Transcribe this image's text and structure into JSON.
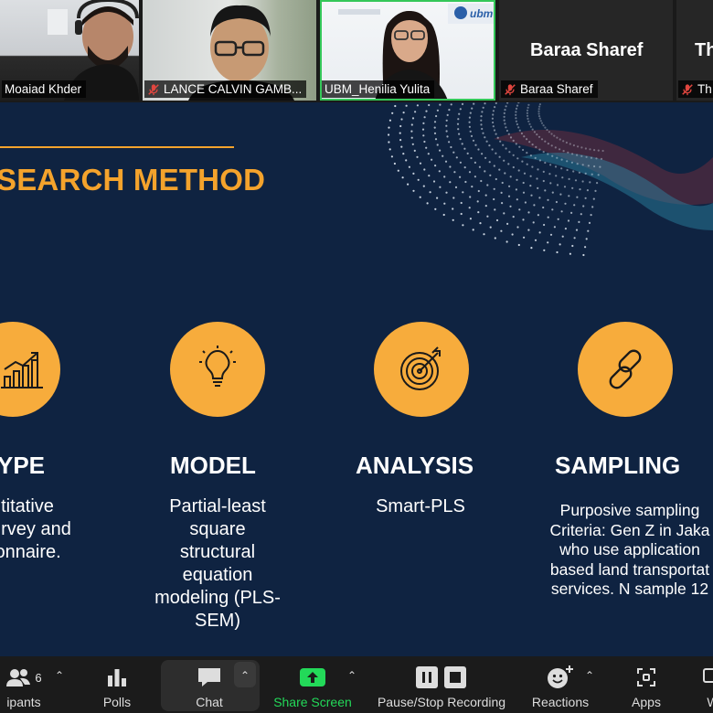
{
  "participants": [
    {
      "name": "Moaiad Khder",
      "name_shown": "Moaiad Khder",
      "muted": false
    },
    {
      "name": "LANCE CALVIN GAMB...",
      "muted": true
    },
    {
      "name": "UBM_Henilia Yulita",
      "muted": false,
      "active_speaker": true
    },
    {
      "name": "Baraa Sharef",
      "big_name": "Baraa Sharef",
      "muted": true
    },
    {
      "name": "Th",
      "big_name": "Th",
      "muted": true
    }
  ],
  "slide": {
    "title": "SEARCH METHOD",
    "columns": [
      {
        "heading": "YPE",
        "icon": "chart-growth-icon",
        "lines": [
          "ntitative",
          "urvey and",
          "ionnaire."
        ]
      },
      {
        "heading": "MODEL",
        "icon": "lightbulb-icon",
        "lines": [
          "Partial-least",
          "square",
          "structural",
          "equation",
          "modeling (PLS-",
          "SEM)"
        ]
      },
      {
        "heading": "ANALYSIS",
        "icon": "target-icon",
        "lines": [
          "Smart-PLS"
        ]
      },
      {
        "heading": "SAMPLING",
        "icon": "link-icon",
        "lines": [
          "Purposive sampling",
          "Criteria: Gen Z in Jaka",
          "who use application",
          "based land transportat",
          "services. N sample 12"
        ]
      }
    ],
    "colors": {
      "background": "#0f2341",
      "accent": "#f4a32c",
      "circle": "#f7ac3c"
    }
  },
  "toolbar": {
    "participants_label": "ipants",
    "participants_count": "6",
    "polls_label": "Polls",
    "chat_label": "Chat",
    "share_label": "Share Screen",
    "record_label": "Pause/Stop Recording",
    "reactions_label": "Reactions",
    "apps_label": "Apps",
    "more_label": "W"
  },
  "colors": {
    "share_green": "#23d959",
    "active_border": "#34c759"
  }
}
